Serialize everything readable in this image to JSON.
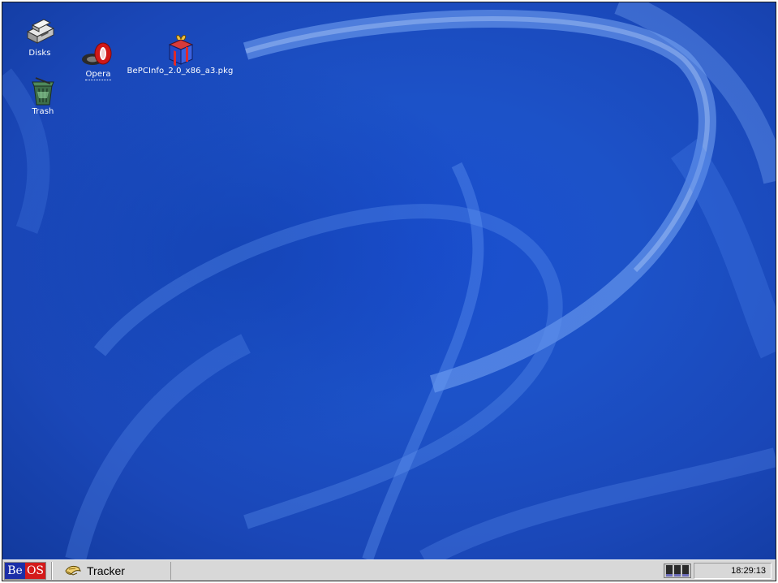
{
  "desktop": {
    "icons": {
      "disks": {
        "label": "Disks",
        "icon": "disks-icon"
      },
      "trash": {
        "label": "Trash",
        "icon": "trash-icon"
      },
      "opera": {
        "label": "Opera",
        "icon": "opera-icon"
      },
      "package": {
        "label": "BePCInfo_2.0_x86_a3.pkg",
        "icon": "package-icon"
      }
    }
  },
  "taskbar": {
    "be_menu": {
      "be": "Be",
      "os": "OS"
    },
    "tracker": {
      "label": "Tracker",
      "icon": "tracker-icon"
    },
    "cpu_monitor": {
      "icon": "cpu-monitor-icon"
    },
    "clock": "18:29:13"
  },
  "colors": {
    "desktop_blue": "#1c52c8",
    "taskbar_gray": "#d8d8d8",
    "be_blue": "#1b2fa8",
    "os_red": "#d41a1a"
  }
}
